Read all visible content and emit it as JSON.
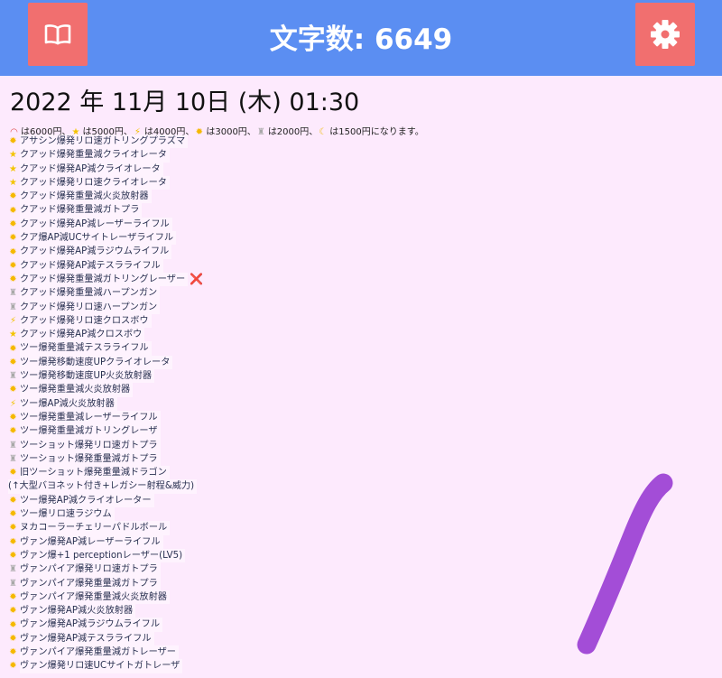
{
  "header": {
    "title": "文字数: 6649",
    "left_button_icon": "book-icon",
    "right_button_icon": "gear-icon",
    "bar_color": "#5b8ef2",
    "button_color": "#f16f6f"
  },
  "datetime": "2022 年 11月 10日 (木) 01:30",
  "info": {
    "parts": [
      {
        "icon": "rainbow",
        "text": "は6000円、"
      },
      {
        "icon": "star",
        "text": "は5000円、"
      },
      {
        "icon": "bolt",
        "text": "は4000円、"
      },
      {
        "icon": "sun",
        "text": "は3000円、"
      },
      {
        "icon": "bag",
        "text": "は2000円、"
      },
      {
        "icon": "moon",
        "text": "は1500円になります。"
      }
    ]
  },
  "items": [
    {
      "icon": "sun",
      "text": "アサシン爆発リロ速ガトリングプラズマ"
    },
    {
      "icon": "star",
      "text": "クアッド爆発重量減クライオレータ"
    },
    {
      "icon": "star",
      "text": "クアッド爆発AP減クライオレータ"
    },
    {
      "icon": "star",
      "text": "クアッド爆発リロ速クライオレータ"
    },
    {
      "icon": "sun",
      "text": "クアッド爆発重量減火炎放射器"
    },
    {
      "icon": "sun",
      "text": "クアッド爆発重量減ガトプラ"
    },
    {
      "icon": "sun",
      "text": "クアッド爆発AP減レーザーライフル"
    },
    {
      "icon": "sun",
      "text": "クア爆AP減UCサイトレーザライフル"
    },
    {
      "icon": "sun",
      "text": "クアッド爆発AP減ラジウムライフル"
    },
    {
      "icon": "sun",
      "text": "クアッド爆発AP減テスラライフル"
    },
    {
      "icon": "sun",
      "text": "クアッド爆発重量減ガトリングレーザー",
      "mark": "❌"
    },
    {
      "icon": "bag",
      "text": "クアッド爆発重量減ハープンガン"
    },
    {
      "icon": "bag",
      "text": "クアッド爆発リロ速ハープンガン"
    },
    {
      "icon": "bolt",
      "text": "クアッド爆発リロ速クロスボウ"
    },
    {
      "icon": "star",
      "text": "クアッド爆発AP減クロスボウ"
    },
    {
      "icon": "sun",
      "text": "ツー爆発重量減テスラライフル"
    },
    {
      "icon": "sun",
      "text": "ツー爆発移動速度UPクライオレータ"
    },
    {
      "icon": "bag",
      "text": "ツー爆発移動速度UP火炎放射器"
    },
    {
      "icon": "sun",
      "text": "ツー爆発重量減火炎放射器"
    },
    {
      "icon": "bolt",
      "text": "ツー爆AP減火炎放射器"
    },
    {
      "icon": "sun",
      "text": "ツー爆発重量減レーザーライフル"
    },
    {
      "icon": "sun",
      "text": "ツー爆発重量減ガトリングレーザ"
    },
    {
      "icon": "bag",
      "text": "ツーショット爆発リロ速ガトプラ"
    },
    {
      "icon": "bag",
      "text": "ツーショット爆発重量減ガトプラ"
    },
    {
      "icon": "sun",
      "text": "旧ツーショット爆発重量減ドラゴン"
    },
    {
      "icon": "none",
      "text": "(↑大型バヨネット付き+レガシー射程&威力)"
    },
    {
      "icon": "sun",
      "text": "ツー爆発AP減クライオレーター"
    },
    {
      "icon": "sun",
      "text": "ツー爆リロ速ラジウム"
    },
    {
      "icon": "sun",
      "text": "ヌカコーラーチェリーパドルボール"
    },
    {
      "icon": "sun",
      "text": "ヴァン爆発AP減レーザーライフル"
    },
    {
      "icon": "sun",
      "text": "ヴァン爆+1 perceptionレーザー(LV5)"
    },
    {
      "icon": "bag",
      "text": "ヴァンパイア爆発リロ速ガトプラ"
    },
    {
      "icon": "bag",
      "text": "ヴァンパイア爆発重量減ガトプラ"
    },
    {
      "icon": "sun",
      "text": "ヴァンパイア爆発重量減火炎放射器"
    },
    {
      "icon": "sun",
      "text": "ヴァン爆発AP減火炎放射器"
    },
    {
      "icon": "sun",
      "text": "ヴァン爆発AP減ラジウムライフル"
    },
    {
      "icon": "sun",
      "text": "ヴァン爆発AP減テスラライフル"
    },
    {
      "icon": "sun",
      "text": "ヴァンパイア爆発重量減ガトレーザー"
    },
    {
      "icon": "sun",
      "text": "ヴァン爆発リロ速UCサイトガトレーザ"
    }
  ],
  "annotation": {
    "color": "#9b3fd4"
  }
}
